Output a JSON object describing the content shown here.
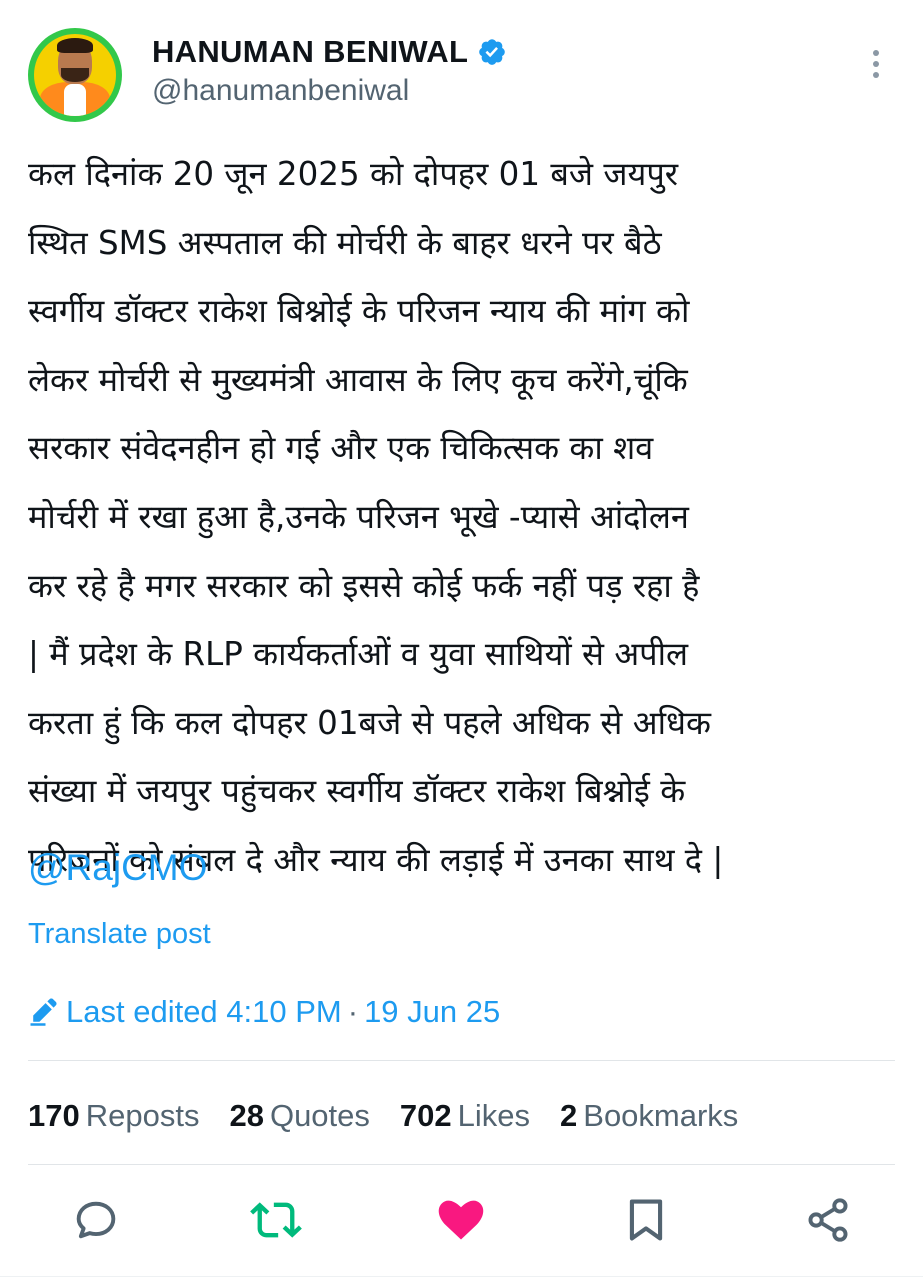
{
  "author": {
    "name": "HANUMAN BENIWAL",
    "handle": "@hanumanbeniwal",
    "verified": true,
    "avatar_icon": "profile-photo"
  },
  "post": {
    "lines": [
      "कल दिनांक 20 जून 2025 को दोपहर 01 बजे जयपुर",
      "स्थित SMS अस्पताल की मोर्चरी के बाहर धरने पर बैठे",
      "स्वर्गीय डॉक्टर राकेश बिश्नोई के परिजन न्याय की मांग को",
      "लेकर मोर्चरी से मुख्यमंत्री आवास के लिए कूच करेंगे,चूंकि",
      "सरकार संवेदनहीन हो गई और एक चिकित्सक का शव",
      "मोर्चरी में रखा हुआ है,उनके परिजन भूखे -प्यासे आंदोलन",
      "कर रहे है मगर सरकार को इससे कोई फर्क नहीं पड़ रहा है",
      "| मैं प्रदेश के RLP कार्यकर्ताओं व युवा साथियों से अपील",
      "करता हुं कि कल दोपहर 01बजे से पहले अधिक से अधिक",
      "संख्या में जयपुर पहुंचकर स्वर्गीय डॉक्टर राकेश बिश्नोई के",
      "परिजनों को संबल दे और न्याय की लड़ाई में उनका साथ दे |"
    ],
    "mention": "@RajCMO",
    "translate_label": "Translate post",
    "edited_label": "Last edited 4:10 PM",
    "separator": "·",
    "date": "19 Jun 25"
  },
  "stats": {
    "reposts": {
      "count": "170",
      "label": "Reposts"
    },
    "quotes": {
      "count": "28",
      "label": "Quotes"
    },
    "likes": {
      "count": "702",
      "label": "Likes"
    },
    "bookmarks": {
      "count": "2",
      "label": "Bookmarks"
    }
  },
  "actions": {
    "reply_icon": "reply-icon",
    "repost_icon": "repost-icon",
    "like_icon": "heart-icon",
    "bookmark_icon": "bookmark-icon",
    "share_icon": "share-icon"
  },
  "colors": {
    "accent": "#1d9bf0",
    "repost_active": "#00ba7c",
    "like_active": "#f91880",
    "text": "#0f1419",
    "muted": "#536471"
  }
}
